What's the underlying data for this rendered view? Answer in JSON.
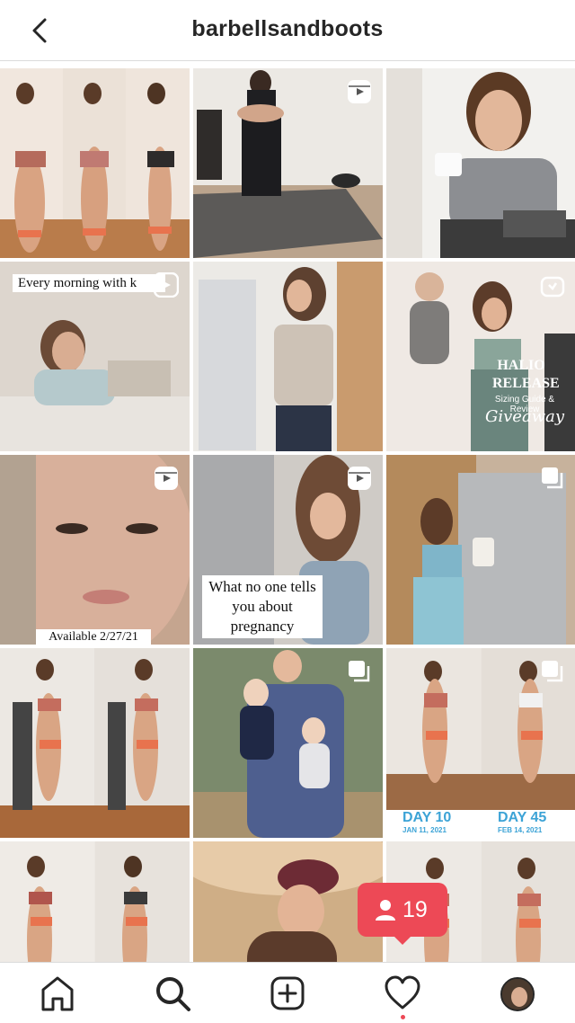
{
  "header": {
    "title": "barbellsandboots",
    "back_icon": "chevron-left-icon"
  },
  "posts": [
    {
      "type": "photo",
      "overlay": ""
    },
    {
      "type": "reel",
      "overlay": ""
    },
    {
      "type": "photo",
      "overlay": ""
    },
    {
      "type": "reel",
      "overlay": "Every morning with k"
    },
    {
      "type": "photo",
      "overlay": ""
    },
    {
      "type": "igtv",
      "overlay": "HALIO RELEASE",
      "overlay2": "Sizing Guide & Review",
      "overlay3": "Giveaway"
    },
    {
      "type": "reel",
      "overlay": "Available 2/27/21"
    },
    {
      "type": "reel",
      "overlay": "What no one tells you about pregnancy"
    },
    {
      "type": "carousel",
      "overlay": ""
    },
    {
      "type": "photo",
      "overlay": ""
    },
    {
      "type": "carousel",
      "overlay": ""
    },
    {
      "type": "carousel",
      "overlay": "DAY 10",
      "overlay_date": "JAN 11, 2021",
      "overlay_b": "DAY 45",
      "overlay_b_date": "FEB 14, 2021"
    },
    {
      "type": "photo",
      "overlay": ""
    },
    {
      "type": "photo",
      "overlay": ""
    },
    {
      "type": "photo",
      "overlay": ""
    }
  ],
  "notification": {
    "icon": "person-icon",
    "count": "19",
    "color": "#ed4956"
  },
  "bottom_nav": {
    "items": [
      "home-icon",
      "search-icon",
      "new-post-icon",
      "activity-heart-icon",
      "profile-avatar"
    ],
    "active": "search-icon"
  }
}
